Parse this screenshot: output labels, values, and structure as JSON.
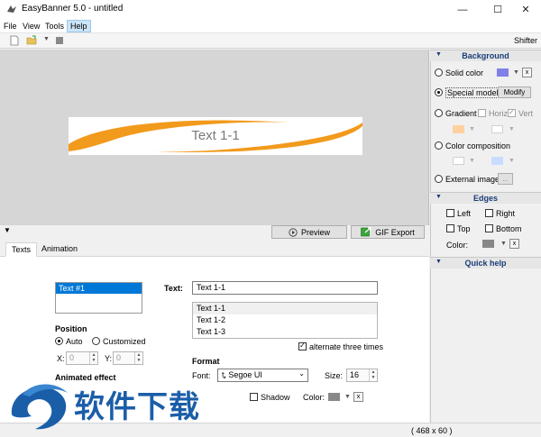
{
  "window": {
    "title": "EasyBanner 5.0 - untitled",
    "min_glyph": "—",
    "max_glyph": "☐",
    "close_glyph": "✕"
  },
  "menu": {
    "file": "File",
    "view": "View",
    "tools": "Tools",
    "help": "Help"
  },
  "toolbar": {
    "shifter_label": "Shifter"
  },
  "banner": {
    "text": "Text 1-1"
  },
  "actions": {
    "preview": "Preview",
    "gif_export": "GIF Export"
  },
  "tabs": {
    "texts": "Texts",
    "animation": "Animation"
  },
  "texts_panel": {
    "list_items": [
      "Text #1"
    ],
    "position_label": "Position",
    "auto_label": "Auto",
    "customized_label": "Customized",
    "x_label": "X:",
    "x_value": "0",
    "y_label": "Y:",
    "y_value": "0",
    "animated_effect_label": "Animated effect",
    "text_label": "Text:",
    "text_value": "Text 1-1",
    "lines": [
      "Text 1-1",
      "Text 1-2",
      "Text 1-3"
    ],
    "alternate_label": "alternate three times",
    "format_label": "Format",
    "font_label": "Font:",
    "font_value": "Segoe UI",
    "font_glyph": "Ꮏ",
    "size_label": "Size:",
    "size_value": "16",
    "shadow_label": "Shadow",
    "color_label": "Color:",
    "clear": "x"
  },
  "background": {
    "header": "Background",
    "solid_color": "Solid color",
    "special_model": "Special model",
    "modify": "Modify",
    "gradient": "Gradient",
    "horiz": "Horiz",
    "vert": "Vert",
    "color_composition": "Color composition",
    "external_image": "External image",
    "browse": "...",
    "clear": "x"
  },
  "edges": {
    "header": "Edges",
    "left": "Left",
    "right": "Right",
    "top": "Top",
    "bottom": "Bottom",
    "color_label": "Color:",
    "clear": "x"
  },
  "quick_help": {
    "header": "Quick help"
  },
  "status": {
    "dimensions": "( 468 x 60 )"
  },
  "watermark": {
    "text": "软件下载"
  },
  "colors": {
    "solid_swatch": "#8080e8",
    "gradient_swatch": "#ffd0a0",
    "composition_swatch2": "#c8dcff",
    "edge_color": "#888888",
    "text_color": "#888888",
    "banner_orange": "#f29a1c",
    "selection": "#0078d7",
    "panel_header_text": "#1a3d78"
  },
  "icons": {
    "app": "easybanner-app-icon",
    "new": "new-file-icon",
    "open": "open-folder-icon",
    "stop": "stop-icon",
    "preview": "play-circle-icon",
    "gif": "gif-export-icon"
  }
}
